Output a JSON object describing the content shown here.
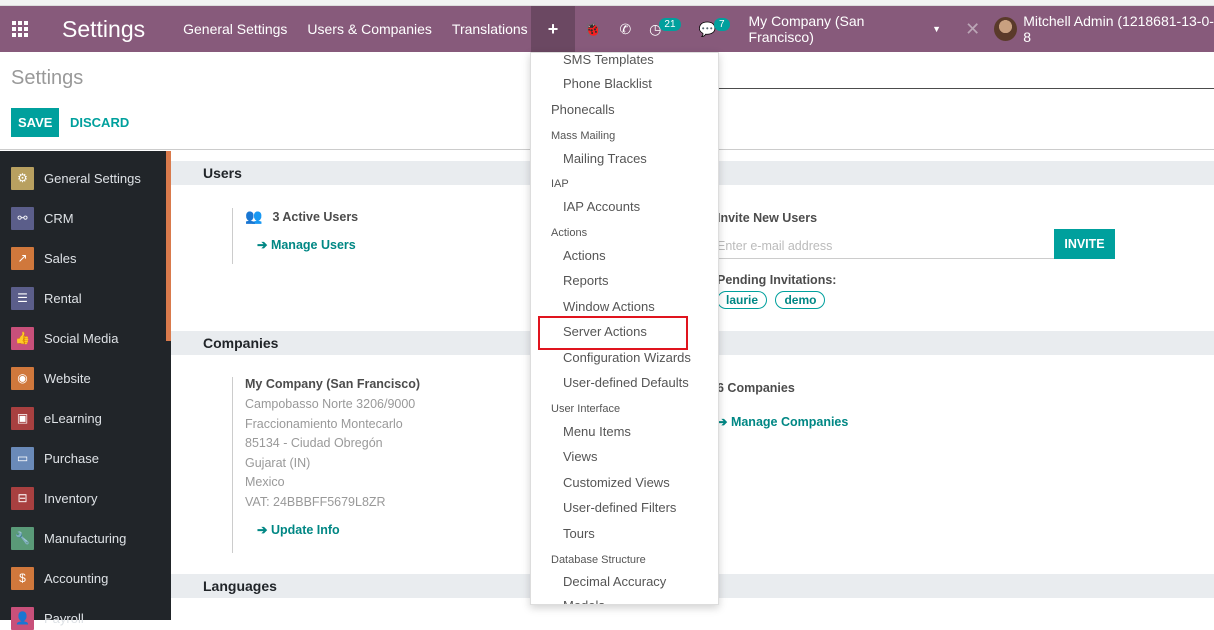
{
  "navbar": {
    "brand": "Settings",
    "menu": [
      "General Settings",
      "Users & Companies",
      "Translations"
    ],
    "plus_label": "+",
    "activity_badge": "21",
    "messages_badge": "7",
    "company": "My Company (San Francisco)",
    "user": "Mitchell Admin (1218681-13-0-8"
  },
  "control_panel": {
    "title": "Settings",
    "save": "SAVE",
    "discard": "DISCARD"
  },
  "sidebar": {
    "items": [
      {
        "label": "General Settings",
        "icon": "gear-icon",
        "color": "#b8a060",
        "glyph": "⚙"
      },
      {
        "label": "CRM",
        "icon": "handshake-icon",
        "color": "#5b5e8a",
        "glyph": "⚯"
      },
      {
        "label": "Sales",
        "icon": "chart-icon",
        "color": "#d0783c",
        "glyph": "↗"
      },
      {
        "label": "Rental",
        "icon": "rental-icon",
        "color": "#5b5e8a",
        "glyph": "☰"
      },
      {
        "label": "Social Media",
        "icon": "thumbs-up-icon",
        "color": "#c8507a",
        "glyph": "👍"
      },
      {
        "label": "Website",
        "icon": "globe-icon",
        "color": "#d0783c",
        "glyph": "◉"
      },
      {
        "label": "eLearning",
        "icon": "elearning-icon",
        "color": "#a84040",
        "glyph": "▣"
      },
      {
        "label": "Purchase",
        "icon": "card-icon",
        "color": "#6a8ab8",
        "glyph": "▭"
      },
      {
        "label": "Inventory",
        "icon": "box-icon",
        "color": "#a84040",
        "glyph": "⊟"
      },
      {
        "label": "Manufacturing",
        "icon": "wrench-icon",
        "color": "#5a9a78",
        "glyph": "🔧"
      },
      {
        "label": "Accounting",
        "icon": "invoice-icon",
        "color": "#d0783c",
        "glyph": "$"
      },
      {
        "label": "Payroll",
        "icon": "payroll-icon",
        "color": "#c8507a",
        "glyph": "👤"
      }
    ]
  },
  "users": {
    "heading": "Users",
    "active_users": "3 Active Users",
    "manage_users": "➔ Manage Users",
    "invite_title": "Invite New Users",
    "invite_placeholder": "Enter e-mail address",
    "invite_button": "INVITE",
    "pending_title": "Pending Invitations:",
    "pending": [
      "laurie",
      "demo"
    ]
  },
  "companies": {
    "heading": "Companies",
    "name": "My Company (San Francisco)",
    "address": [
      "Campobasso Norte 3206/9000",
      "Fraccionamiento Montecarlo",
      "85134 - Ciudad Obregón",
      "Gujarat (IN)",
      "Mexico",
      "VAT: 24BBBFF5679L8ZR"
    ],
    "update_info": "➔ Update Info",
    "count": "6 Companies",
    "manage_companies": "➔ Manage Companies"
  },
  "languages": {
    "heading": "Languages"
  },
  "dropdown": {
    "entries": [
      {
        "type": "item",
        "label": "SMS Templates"
      },
      {
        "type": "item",
        "label": "Phone Blacklist"
      },
      {
        "type": "l1",
        "label": "Phonecalls"
      },
      {
        "type": "header",
        "label": "Mass Mailing"
      },
      {
        "type": "item",
        "label": "Mailing Traces"
      },
      {
        "type": "header",
        "label": "IAP"
      },
      {
        "type": "item",
        "label": "IAP Accounts"
      },
      {
        "type": "header",
        "label": "Actions"
      },
      {
        "type": "item",
        "label": "Actions"
      },
      {
        "type": "item",
        "label": "Reports"
      },
      {
        "type": "item",
        "label": "Window Actions"
      },
      {
        "type": "item",
        "label": "Server Actions",
        "highlighted": true
      },
      {
        "type": "item",
        "label": "Configuration Wizards"
      },
      {
        "type": "item",
        "label": "User-defined Defaults"
      },
      {
        "type": "header",
        "label": "User Interface"
      },
      {
        "type": "item",
        "label": "Menu Items"
      },
      {
        "type": "item",
        "label": "Views"
      },
      {
        "type": "item",
        "label": "Customized Views"
      },
      {
        "type": "item",
        "label": "User-defined Filters"
      },
      {
        "type": "item",
        "label": "Tours"
      },
      {
        "type": "header",
        "label": "Database Structure"
      },
      {
        "type": "item",
        "label": "Decimal Accuracy"
      },
      {
        "type": "item",
        "label": "Models"
      }
    ]
  }
}
